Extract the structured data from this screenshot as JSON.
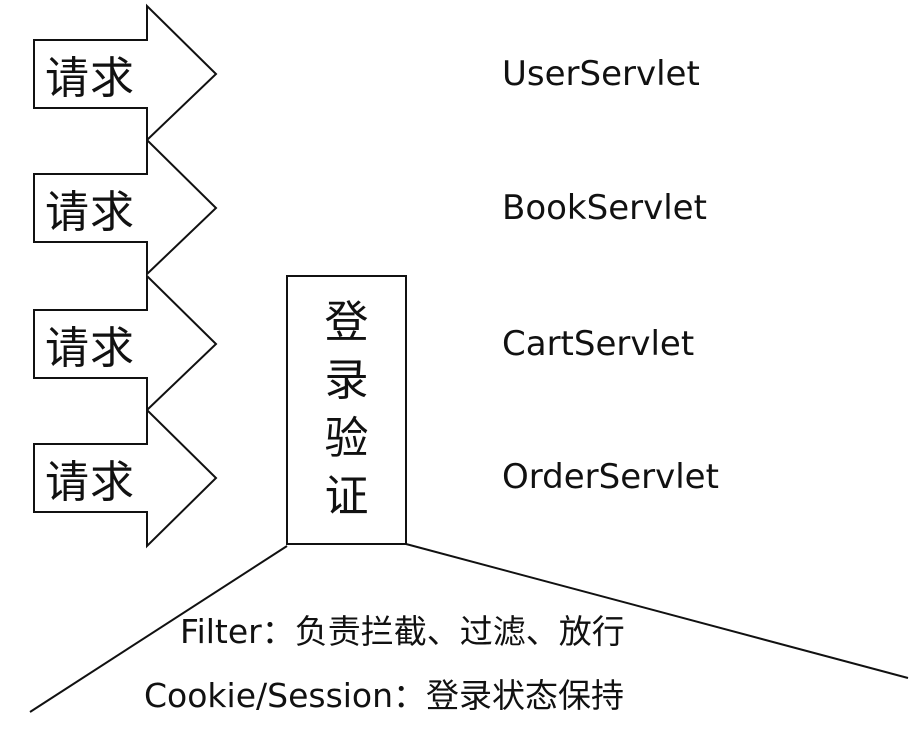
{
  "requests": [
    {
      "label": "请求"
    },
    {
      "label": "请求"
    },
    {
      "label": "请求"
    },
    {
      "label": "请求"
    }
  ],
  "servlets": [
    {
      "name": "UserServlet"
    },
    {
      "name": "BookServlet"
    },
    {
      "name": "CartServlet"
    },
    {
      "name": "OrderServlet"
    }
  ],
  "login_box": {
    "chars": [
      "登",
      "录",
      "验",
      "证"
    ]
  },
  "notes": {
    "filter": "Filter：负责拦截、过滤、放行",
    "session": "Cookie/Session：登录状态保持"
  },
  "colors": {
    "stroke": "#111111",
    "background": "#ffffff"
  }
}
